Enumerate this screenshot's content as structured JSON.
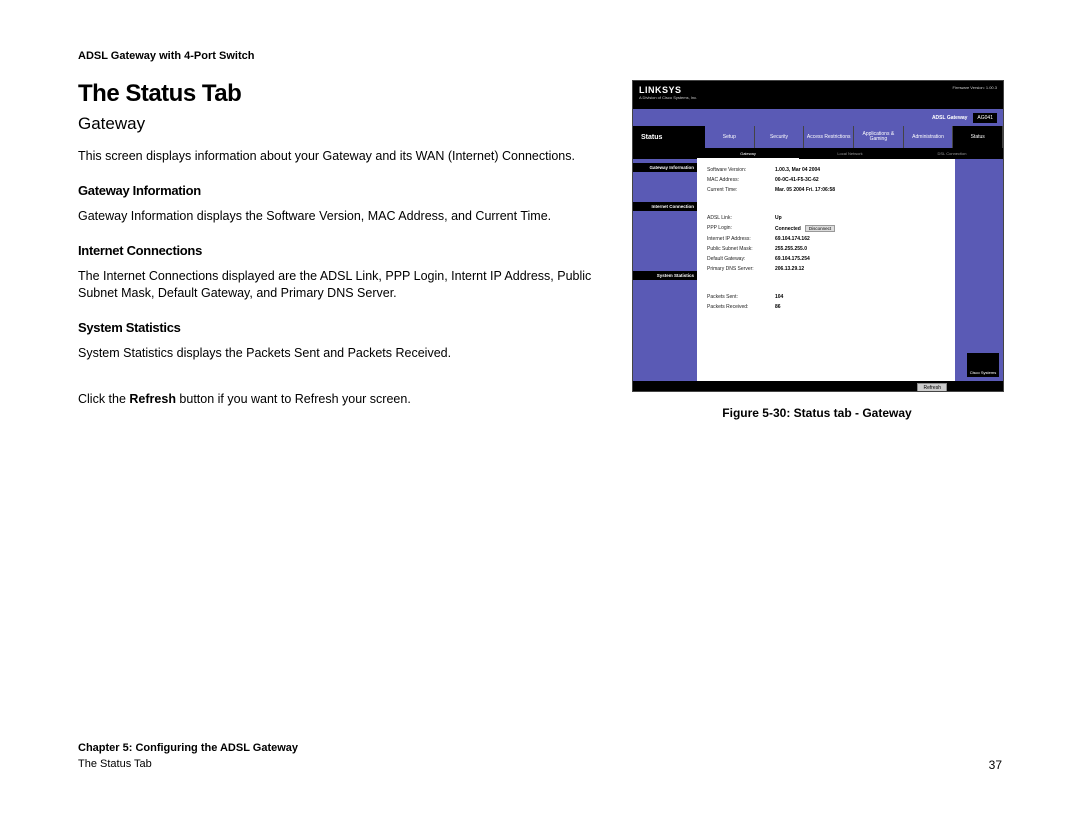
{
  "header": "ADSL Gateway with 4-Port Switch",
  "title": "The Status Tab",
  "subtitle": "Gateway",
  "intro": "This screen displays information about your Gateway and its WAN (Internet) Connections.",
  "sections": {
    "s1": {
      "heading": "Gateway Information",
      "text": "Gateway Information displays the Software Version, MAC Address, and Current Time."
    },
    "s2": {
      "heading": "Internet Connections",
      "text": "The Internet Connections displayed are the ADSL Link, PPP Login, Internt IP Address, Public Subnet Mask, Default Gateway, and Primary DNS Server."
    },
    "s3": {
      "heading": "System Statistics",
      "text": "System Statistics displays the Packets Sent and Packets Received."
    }
  },
  "refresh_note_pre": "Click the ",
  "refresh_bold": "Refresh",
  "refresh_note_post": " button if you want to Refresh your screen.",
  "figure_caption": "Figure 5-30: Status tab - Gateway",
  "footer": {
    "chapter": "Chapter 5: Configuring the ADSL Gateway",
    "section": "The Status Tab",
    "page": "37"
  },
  "router": {
    "brand": "LINKSYS",
    "subbrand": "A Division of Cisco Systems, Inc.",
    "firmware": "Firmware Version: 1.00.3",
    "device": "ADSL Gateway",
    "model": "AG041",
    "status_label": "Status",
    "tabs": [
      "Setup",
      "Security",
      "Access\nRestrictions",
      "Applications\n& Gaming",
      "Administration",
      "Status"
    ],
    "subtabs": [
      "Gateway",
      "Local Network",
      "DSL Connection"
    ],
    "side_labels": [
      "Gateway Information",
      "Internet Connection",
      "System Statistics"
    ],
    "gateway_info": {
      "sw_k": "Software Version:",
      "sw_v": "1.00.3, Mar 04 2004",
      "mac_k": "MAC Address:",
      "mac_v": "00-0C-41-F5-3C-62",
      "time_k": "Current Time:",
      "time_v": "Mar. 05 2004 Fri. 17:06:58"
    },
    "internet": {
      "adsl_k": "ADSL Link:",
      "adsl_v": "Up",
      "ppp_k": "PPP Login:",
      "ppp_v": "Connected",
      "disc": "Disconnect",
      "ip_k": "Internet IP Address:",
      "ip_v": "69.104.174.162",
      "mask_k": "Public Subnet Mask:",
      "mask_v": "255.255.255.0",
      "gw_k": "Default Gateway:",
      "gw_v": "69.104.175.254",
      "dns_k": "Primary DNS Server:",
      "dns_v": "206.13.29.12"
    },
    "stats": {
      "sent_k": "Packets Sent:",
      "sent_v": "104",
      "recv_k": "Packets Received:",
      "recv_v": "86"
    },
    "refresh_btn": "Refresh",
    "cisco": "Cisco Systems"
  }
}
